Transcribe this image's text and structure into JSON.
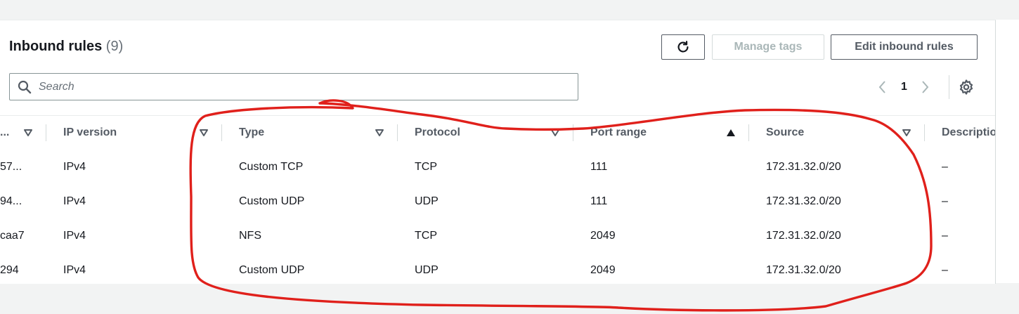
{
  "header": {
    "title": "Inbound rules",
    "count": "(9)",
    "refresh_icon": "refresh-icon",
    "manage_tags_label": "Manage tags",
    "edit_rules_label": "Edit inbound rules"
  },
  "search": {
    "placeholder": "Search",
    "icon": "search-icon",
    "value": ""
  },
  "pagination": {
    "current_page": "1",
    "prev_icon": "chevron-left-icon",
    "next_icon": "chevron-right-icon",
    "settings_icon": "gear-icon"
  },
  "table": {
    "columns": [
      {
        "label": "...",
        "sort": "caret-down"
      },
      {
        "label": "IP version",
        "sort": "caret-down"
      },
      {
        "label": "Type",
        "sort": "caret-down"
      },
      {
        "label": "Protocol",
        "sort": "caret-down"
      },
      {
        "label": "Port range",
        "sort": "sorted-ascending"
      },
      {
        "label": "Source",
        "sort": "caret-down"
      },
      {
        "label": "Descriptio",
        "sort": ""
      }
    ],
    "rows": [
      {
        "id": "57...",
        "ip_version": "IPv4",
        "type": "Custom TCP",
        "protocol": "TCP",
        "port_range": "111",
        "source": "172.31.32.0/20",
        "description": "–"
      },
      {
        "id": "94...",
        "ip_version": "IPv4",
        "type": "Custom UDP",
        "protocol": "UDP",
        "port_range": "111",
        "source": "172.31.32.0/20",
        "description": "–"
      },
      {
        "id": "caa7",
        "ip_version": "IPv4",
        "type": "NFS",
        "protocol": "TCP",
        "port_range": "2049",
        "source": "172.31.32.0/20",
        "description": "–"
      },
      {
        "id": "294",
        "ip_version": "IPv4",
        "type": "Custom UDP",
        "protocol": "UDP",
        "port_range": "2049",
        "source": "172.31.32.0/20",
        "description": "–"
      }
    ]
  },
  "annotation": {
    "color": "#e0201b"
  },
  "colors": {
    "text": "#16191f",
    "secondary": "#545b64",
    "border": "#eaeded",
    "disabled": "#aab7b8"
  }
}
